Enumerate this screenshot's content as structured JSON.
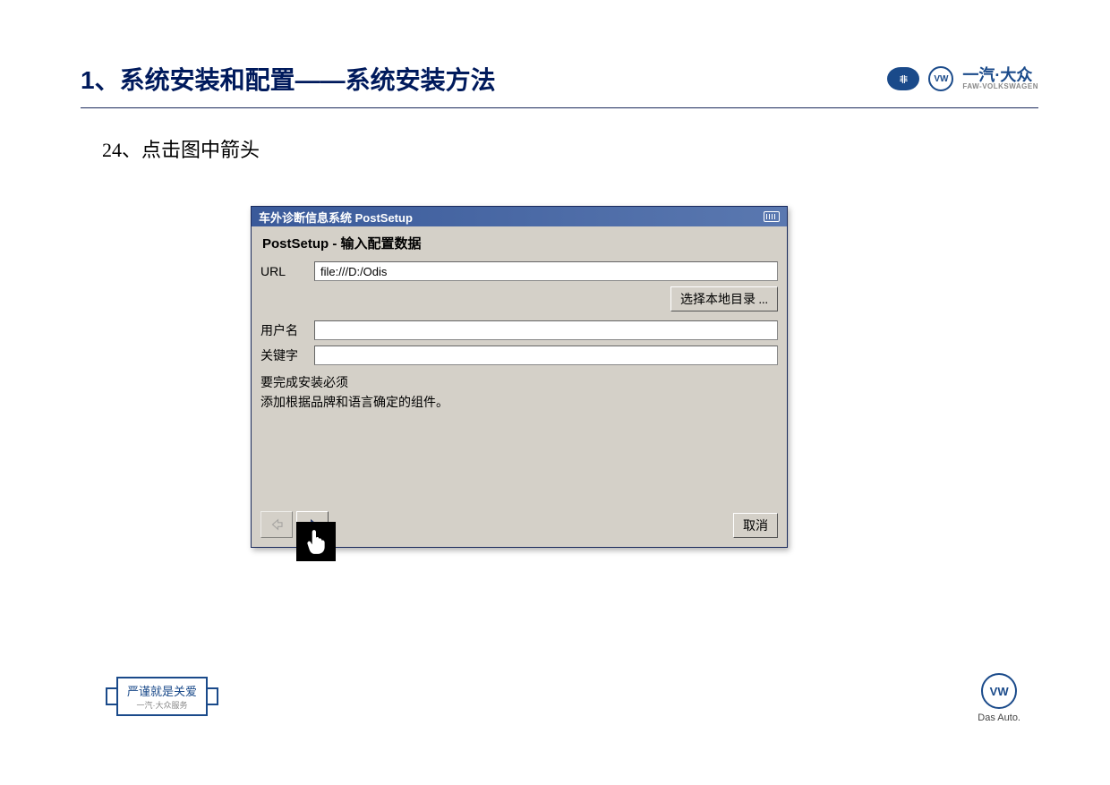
{
  "header": {
    "title": "1、系统安装和配置——系统安装方法",
    "brand_text_main": "一汽·大众",
    "brand_text_sub": "FAW-VOLKSWAGEN"
  },
  "step_text": "24、点击图中箭头",
  "window": {
    "title": "车外诊断信息系统 PostSetup",
    "subtitle": "PostSetup - 输入配置数据",
    "url_label": "URL",
    "url_value": "file:///D:/Odis",
    "browse_button": "选择本地目录 ...",
    "username_label": "用户名",
    "username_value": "",
    "keyword_label": "关键字",
    "keyword_value": "",
    "info_text": "要完成安装必须\n添加根据品牌和语言确定的组件。",
    "cancel_button": "取消"
  },
  "footer": {
    "badge_main": "严谨就是关爱",
    "badge_sub": "一汽·大众服务",
    "dasauto": "Das Auto."
  }
}
